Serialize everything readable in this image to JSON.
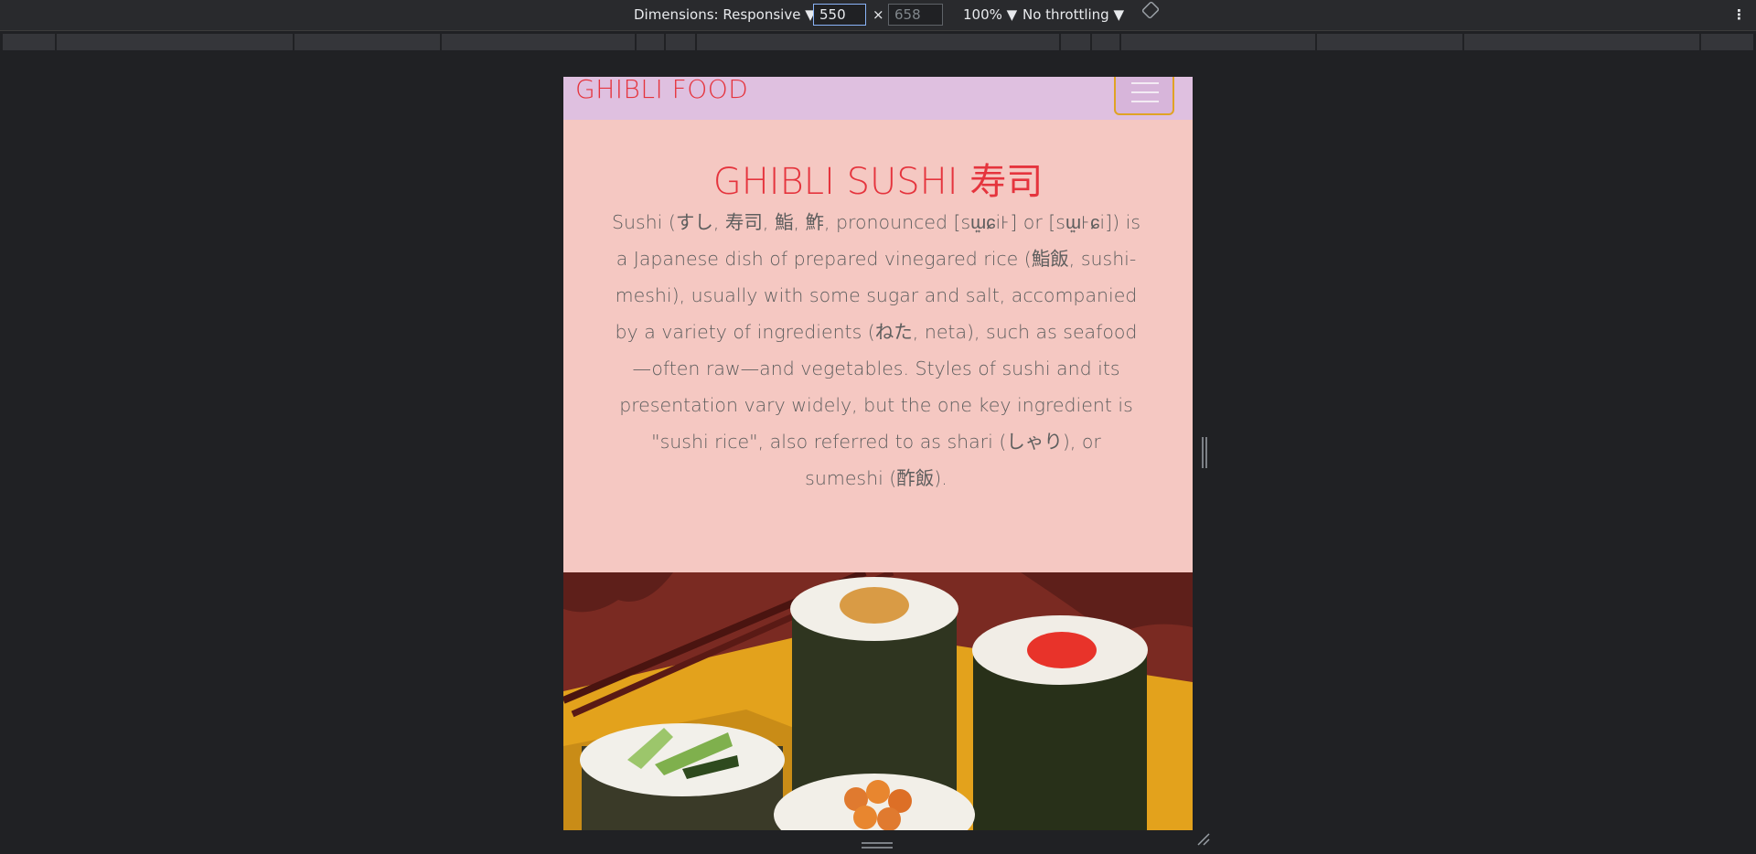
{
  "devtools": {
    "dimensions_label": "Dimensions: Responsive ▼",
    "width_value": "550",
    "times_sign": "×",
    "height_value": "658",
    "zoom_label": "100% ▼",
    "throttle_label": "No throttling ▼",
    "more_label": "⋮"
  },
  "site": {
    "brand": "GHIBLI FOOD",
    "hero_title": "GHIBLI SUSHI 寿司",
    "hero_text": "Sushi (すし, 寿司, 鮨, 鮓, pronounced [sɯ͍ɕi꜔] or [sɯ͍꜔ɕi]) is a Japanese dish of prepared vinegared rice (鮨飯, sushi-meshi), usually with some sugar and salt, accompanied by a variety of ingredients (ねた, neta), such as seafood—often raw—and vegetables. Styles of sushi and its presentation vary widely, but the one key ingredient is \"sushi rice\", also referred to as shari (しゃり), or sumeshi (酢飯).",
    "image_name": "sushi-illustration"
  },
  "colors": {
    "brand_red": "#e5343d",
    "navbar_bg": "#dfc0e0",
    "hero_bg": "#f5c8c2",
    "toggler_border": "#e0a324"
  }
}
